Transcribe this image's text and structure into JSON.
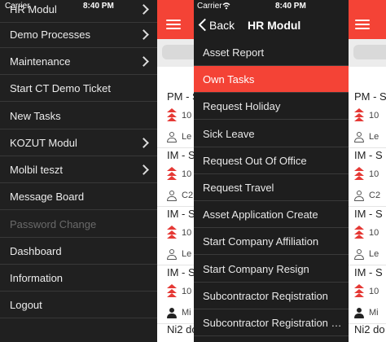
{
  "side_menu": {
    "status": {
      "carrier": "Carrier",
      "time": "8:40 PM"
    },
    "items": [
      {
        "label": "HR Modul",
        "chevron": true,
        "disabled": false
      },
      {
        "label": "Demo Processes",
        "chevron": true,
        "disabled": false
      },
      {
        "label": "Maintenance",
        "chevron": true,
        "disabled": false
      },
      {
        "label": "Start CT Demo Ticket",
        "chevron": false,
        "disabled": false
      },
      {
        "label": "New Tasks",
        "chevron": false,
        "disabled": false
      },
      {
        "label": "KOZUT Modul",
        "chevron": true,
        "disabled": false
      },
      {
        "label": "Molbil teszt",
        "chevron": true,
        "disabled": false
      },
      {
        "label": "Message Board",
        "chevron": false,
        "disabled": false
      },
      {
        "label": "Password Change",
        "chevron": false,
        "disabled": true
      },
      {
        "label": "Dashboard",
        "chevron": false,
        "disabled": false
      },
      {
        "label": "Information",
        "chevron": false,
        "disabled": false
      },
      {
        "label": "Logout",
        "chevron": false,
        "disabled": false
      }
    ]
  },
  "feed_left": {
    "cards": [
      {
        "title": "PM - S",
        "line1": "10",
        "line2": "Le",
        "person": "outline"
      },
      {
        "title": "IM - S",
        "line1": "10",
        "line2": "C2",
        "person": "outline"
      },
      {
        "title": "IM - S",
        "line1": "10",
        "line2": "Le",
        "person": "outline"
      },
      {
        "title": "IM - S",
        "line1": "10",
        "line2": "Mi",
        "person": "filled"
      }
    ],
    "partial_title": "Ni2 do"
  },
  "hr_modul": {
    "status": {
      "carrier": "Carrier",
      "time": "8:40 PM"
    },
    "back_label": "Back",
    "title": "HR Modul",
    "selected_color": "#f44336",
    "items": [
      {
        "label": "Asset Report",
        "selected": false
      },
      {
        "label": "Own Tasks",
        "selected": true
      },
      {
        "label": "Request Holiday",
        "selected": false
      },
      {
        "label": "Sick Leave",
        "selected": false
      },
      {
        "label": "Request Out Of Office",
        "selected": false
      },
      {
        "label": "Request Travel",
        "selected": false
      },
      {
        "label": "Asset Application Create",
        "selected": false
      },
      {
        "label": "Start Company Affiliation",
        "selected": false
      },
      {
        "label": "Start Company Resign",
        "selected": false
      },
      {
        "label": "Subcontractor Reqistration",
        "selected": false
      },
      {
        "label": "Subcontractor Registration Request",
        "selected": false
      }
    ]
  },
  "feed_right": {
    "cards": [
      {
        "title": "PM - S",
        "line1": "10",
        "line2": "Le",
        "person": "outline"
      },
      {
        "title": "IM - S",
        "line1": "10",
        "line2": "C2",
        "person": "outline"
      },
      {
        "title": "IM - S",
        "line1": "10",
        "line2": "Le",
        "person": "outline"
      },
      {
        "title": "IM - S",
        "line1": "10",
        "line2": "Mi",
        "person": "filled"
      }
    ],
    "partial_title": "Ni2 do"
  },
  "colors": {
    "accent": "#f44336",
    "menu_bg": "#202020",
    "priority": "#e53935"
  }
}
